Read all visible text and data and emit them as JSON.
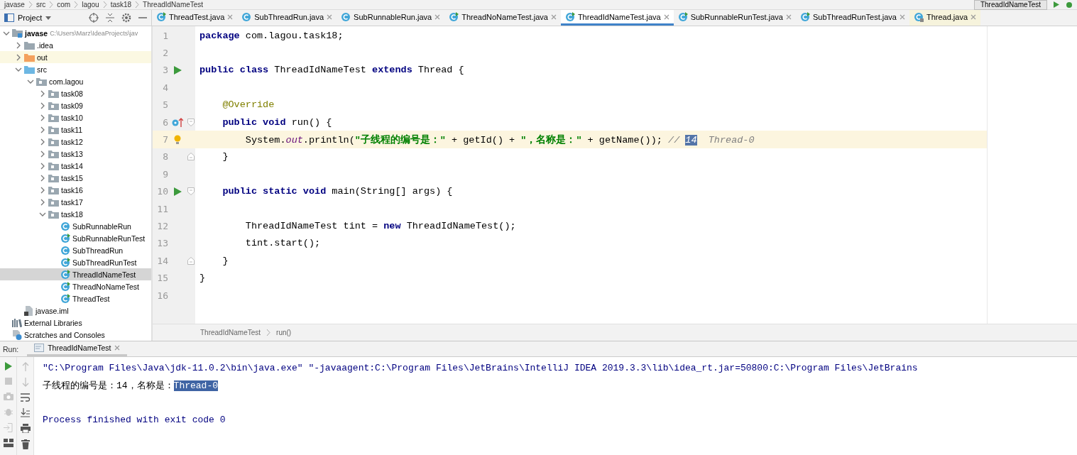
{
  "navigation_bar": {
    "crumbs": [
      "javase",
      "src",
      "com",
      "lagou",
      "task18",
      "ThreadIdNameTest"
    ],
    "run_configuration": "ThreadIdNameTest"
  },
  "project_panel": {
    "title": "Project",
    "tree": [
      {
        "name": "javase",
        "kind": "module",
        "detail": "C:\\Users\\Marz\\IdeaProjects\\jav",
        "expanded": true,
        "selected": false,
        "children": [
          {
            "name": ".idea",
            "kind": "folder",
            "expanded": false,
            "selected": false
          },
          {
            "name": "out",
            "kind": "excluded-folder",
            "expanded": false,
            "selected": false
          },
          {
            "name": "src",
            "kind": "source-folder",
            "expanded": true,
            "selected": false,
            "children": [
              {
                "name": "com.lagou",
                "kind": "package",
                "expanded": true,
                "selected": false,
                "children": [
                  {
                    "name": "task08",
                    "kind": "package",
                    "expanded": false,
                    "selected": false
                  },
                  {
                    "name": "task09",
                    "kind": "package",
                    "expanded": false,
                    "selected": false
                  },
                  {
                    "name": "task10",
                    "kind": "package",
                    "expanded": false,
                    "selected": false
                  },
                  {
                    "name": "task11",
                    "kind": "package",
                    "expanded": false,
                    "selected": false
                  },
                  {
                    "name": "task12",
                    "kind": "package",
                    "expanded": false,
                    "selected": false
                  },
                  {
                    "name": "task13",
                    "kind": "package",
                    "expanded": false,
                    "selected": false
                  },
                  {
                    "name": "task14",
                    "kind": "package",
                    "expanded": false,
                    "selected": false
                  },
                  {
                    "name": "task15",
                    "kind": "package",
                    "expanded": false,
                    "selected": false
                  },
                  {
                    "name": "task16",
                    "kind": "package",
                    "expanded": false,
                    "selected": false
                  },
                  {
                    "name": "task17",
                    "kind": "package",
                    "expanded": false,
                    "selected": false
                  },
                  {
                    "name": "task18",
                    "kind": "package",
                    "expanded": true,
                    "selected": false,
                    "children": [
                      {
                        "name": "SubRunnableRun",
                        "kind": "class",
                        "selected": false
                      },
                      {
                        "name": "SubRunnableRunTest",
                        "kind": "runnable-class",
                        "selected": false
                      },
                      {
                        "name": "SubThreadRun",
                        "kind": "class",
                        "selected": false
                      },
                      {
                        "name": "SubThreadRunTest",
                        "kind": "runnable-class",
                        "selected": false
                      },
                      {
                        "name": "ThreadIdNameTest",
                        "kind": "runnable-class",
                        "selected": true
                      },
                      {
                        "name": "ThreadNoNameTest",
                        "kind": "runnable-class",
                        "selected": false
                      },
                      {
                        "name": "ThreadTest",
                        "kind": "runnable-class",
                        "selected": false
                      }
                    ]
                  }
                ]
              }
            ]
          },
          {
            "name": "javase.iml",
            "kind": "iml",
            "selected": false
          }
        ]
      },
      {
        "name": "External Libraries",
        "kind": "libraries",
        "selected": false
      },
      {
        "name": "Scratches and Consoles",
        "kind": "scratches",
        "selected": false
      }
    ]
  },
  "editor_tabs": [
    {
      "label": "ThreadTest.java",
      "kind": "runnable-class",
      "selected": false
    },
    {
      "label": "SubThreadRun.java",
      "kind": "class",
      "selected": false
    },
    {
      "label": "SubRunnableRun.java",
      "kind": "class",
      "selected": false
    },
    {
      "label": "ThreadNoNameTest.java",
      "kind": "runnable-class",
      "selected": false
    },
    {
      "label": "ThreadIdNameTest.java",
      "kind": "runnable-class",
      "selected": true
    },
    {
      "label": "SubRunnableRunTest.java",
      "kind": "runnable-class",
      "selected": false
    },
    {
      "label": "SubThreadRunTest.java",
      "kind": "runnable-class",
      "selected": false
    },
    {
      "label": "Thread.java",
      "kind": "library-class",
      "selected": false
    }
  ],
  "editor": {
    "lines": [
      {
        "number": "1",
        "tokens": [
          {
            "kind": "keyword",
            "text": "package"
          },
          {
            "kind": "plain",
            "text": " com.lagou.task18;"
          }
        ]
      },
      {
        "number": "2"
      },
      {
        "number": "3",
        "run_marker": true,
        "tokens": [
          {
            "kind": "keyword",
            "text": "public class"
          },
          {
            "kind": "plain",
            "text": " ThreadIdNameTest "
          },
          {
            "kind": "keyword",
            "text": "extends"
          },
          {
            "kind": "plain",
            "text": " Thread {"
          }
        ]
      },
      {
        "number": "4"
      },
      {
        "number": "5",
        "tokens": [
          {
            "kind": "annotation",
            "text": "    @Override"
          }
        ]
      },
      {
        "number": "6",
        "override_marker": true,
        "fold_start": true,
        "tokens": [
          {
            "kind": "keyword",
            "text": "    public void"
          },
          {
            "kind": "plain",
            "text": " run() {"
          }
        ]
      },
      {
        "number": "7",
        "bulb": true,
        "current": true,
        "tokens": [
          {
            "kind": "plain",
            "text": "        System."
          },
          {
            "kind": "static-field",
            "text": "out"
          },
          {
            "kind": "plain",
            "text": ".println("
          },
          {
            "kind": "string",
            "text": "\"子线程的编号是：\""
          },
          {
            "kind": "plain",
            "text": " + getId() + "
          },
          {
            "kind": "string",
            "text": "\"，名称是：\""
          },
          {
            "kind": "plain",
            "text": " + getName()); "
          },
          {
            "kind": "comment",
            "text": "// "
          },
          {
            "kind": "selected-value",
            "text": "14"
          },
          {
            "kind": "comment",
            "text": "  Thread-0"
          }
        ]
      },
      {
        "number": "8",
        "fold_end": true,
        "tokens": [
          {
            "kind": "plain",
            "text": "    }"
          }
        ]
      },
      {
        "number": "9"
      },
      {
        "number": "10",
        "run_marker": true,
        "fold_start": true,
        "tokens": [
          {
            "kind": "keyword",
            "text": "    public static void"
          },
          {
            "kind": "plain",
            "text": " main(String[] args) {"
          }
        ]
      },
      {
        "number": "11"
      },
      {
        "number": "12",
        "tokens": [
          {
            "kind": "plain",
            "text": "        ThreadIdNameTest tint = "
          },
          {
            "kind": "keyword",
            "text": "new"
          },
          {
            "kind": "plain",
            "text": " ThreadIdNameTest();"
          }
        ]
      },
      {
        "number": "13",
        "tokens": [
          {
            "kind": "plain",
            "text": "        tint.start();"
          }
        ]
      },
      {
        "number": "14",
        "fold_end": true,
        "tokens": [
          {
            "kind": "plain",
            "text": "    }"
          }
        ]
      },
      {
        "number": "15",
        "tokens": [
          {
            "kind": "plain",
            "text": "}"
          }
        ]
      },
      {
        "number": "16"
      }
    ],
    "breadcrumbs": [
      "ThreadIdNameTest",
      "run()"
    ]
  },
  "run_panel": {
    "label": "Run:",
    "tab": "ThreadIdNameTest",
    "console": [
      [
        {
          "kind": "command",
          "text": "\"C:\\Program Files\\Java\\jdk-11.0.2\\bin\\java.exe\" \"-javaagent:C:\\Program Files\\JetBrains\\IntelliJ IDEA 2019.3.3\\lib\\idea_rt.jar=50800:C:\\Program Files\\JetBrains"
        }
      ],
      [
        {
          "kind": "output",
          "text": "子线程的编号是：14，名称是："
        },
        {
          "kind": "selected-output",
          "text": "Thread-0"
        }
      ],
      [
        {
          "kind": "system",
          "text": "Process finished with exit code 0"
        }
      ]
    ]
  }
}
